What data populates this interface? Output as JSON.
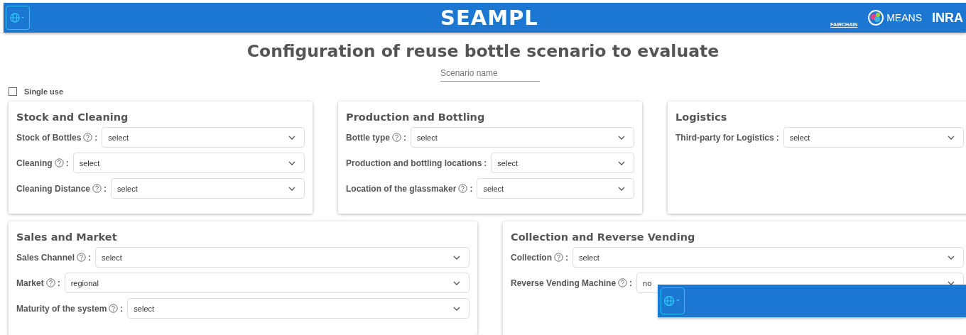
{
  "header": {
    "brand": "SEAMPL",
    "partners": [
      "FAIRCHAIN",
      "MEANS",
      "INRA"
    ]
  },
  "title": "Configuration of reuse bottle scenario to evaluate",
  "scenario_name": {
    "placeholder": "Scenario name"
  },
  "single_use": {
    "label": "Single use",
    "checked": false
  },
  "rows": [
    [
      {
        "title": "Stock and Cleaning",
        "fields": [
          {
            "label": "Stock of Bottles",
            "help": true,
            "suffix": ":",
            "value": "select"
          },
          {
            "label": "Cleaning",
            "help": true,
            "suffix": ":",
            "value": "select"
          },
          {
            "label": "Cleaning Distance",
            "help": true,
            "suffix": ":",
            "value": "select"
          }
        ]
      },
      {
        "title": "Production and Bottling",
        "fields": [
          {
            "label": "Bottle type",
            "help": true,
            "suffix": ":",
            "value": "select"
          },
          {
            "label": "Production and bottling locations",
            "help": false,
            "suffix": ":",
            "value": "select"
          },
          {
            "label": "Location of the glassmaker",
            "help": true,
            "suffix": ":",
            "value": "select"
          }
        ]
      },
      {
        "title": "Logistics",
        "fields": [
          {
            "label": "Third-party for Logistics",
            "help": false,
            "suffix": ":",
            "value": "select"
          }
        ]
      }
    ],
    [
      {
        "title": "Sales and Market",
        "fields": [
          {
            "label": "Sales Channel",
            "help": true,
            "suffix": ":",
            "value": "select"
          },
          {
            "label": "Market",
            "help": true,
            "suffix": ":",
            "value": "regional"
          },
          {
            "label": "Maturity of the system",
            "help": true,
            "suffix": ":",
            "value": "select"
          }
        ]
      },
      {
        "title": "Collection and Reverse Vending",
        "fields": [
          {
            "label": "Collection",
            "help": true,
            "suffix": ":",
            "value": "select"
          },
          {
            "label": "Reverse Vending Machine",
            "help": true,
            "suffix": ":",
            "value": "no"
          }
        ]
      }
    ]
  ]
}
